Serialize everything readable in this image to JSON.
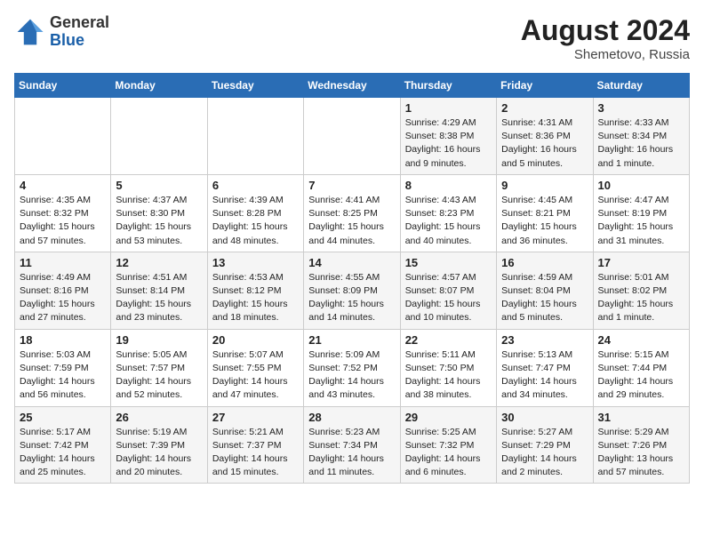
{
  "logo": {
    "general": "General",
    "blue": "Blue"
  },
  "title": {
    "month_year": "August 2024",
    "location": "Shemetovo, Russia"
  },
  "weekdays": [
    "Sunday",
    "Monday",
    "Tuesday",
    "Wednesday",
    "Thursday",
    "Friday",
    "Saturday"
  ],
  "weeks": [
    [
      {
        "day": "",
        "info": ""
      },
      {
        "day": "",
        "info": ""
      },
      {
        "day": "",
        "info": ""
      },
      {
        "day": "",
        "info": ""
      },
      {
        "day": "1",
        "info": "Sunrise: 4:29 AM\nSunset: 8:38 PM\nDaylight: 16 hours\nand 9 minutes."
      },
      {
        "day": "2",
        "info": "Sunrise: 4:31 AM\nSunset: 8:36 PM\nDaylight: 16 hours\nand 5 minutes."
      },
      {
        "day": "3",
        "info": "Sunrise: 4:33 AM\nSunset: 8:34 PM\nDaylight: 16 hours\nand 1 minute."
      }
    ],
    [
      {
        "day": "4",
        "info": "Sunrise: 4:35 AM\nSunset: 8:32 PM\nDaylight: 15 hours\nand 57 minutes."
      },
      {
        "day": "5",
        "info": "Sunrise: 4:37 AM\nSunset: 8:30 PM\nDaylight: 15 hours\nand 53 minutes."
      },
      {
        "day": "6",
        "info": "Sunrise: 4:39 AM\nSunset: 8:28 PM\nDaylight: 15 hours\nand 48 minutes."
      },
      {
        "day": "7",
        "info": "Sunrise: 4:41 AM\nSunset: 8:25 PM\nDaylight: 15 hours\nand 44 minutes."
      },
      {
        "day": "8",
        "info": "Sunrise: 4:43 AM\nSunset: 8:23 PM\nDaylight: 15 hours\nand 40 minutes."
      },
      {
        "day": "9",
        "info": "Sunrise: 4:45 AM\nSunset: 8:21 PM\nDaylight: 15 hours\nand 36 minutes."
      },
      {
        "day": "10",
        "info": "Sunrise: 4:47 AM\nSunset: 8:19 PM\nDaylight: 15 hours\nand 31 minutes."
      }
    ],
    [
      {
        "day": "11",
        "info": "Sunrise: 4:49 AM\nSunset: 8:16 PM\nDaylight: 15 hours\nand 27 minutes."
      },
      {
        "day": "12",
        "info": "Sunrise: 4:51 AM\nSunset: 8:14 PM\nDaylight: 15 hours\nand 23 minutes."
      },
      {
        "day": "13",
        "info": "Sunrise: 4:53 AM\nSunset: 8:12 PM\nDaylight: 15 hours\nand 18 minutes."
      },
      {
        "day": "14",
        "info": "Sunrise: 4:55 AM\nSunset: 8:09 PM\nDaylight: 15 hours\nand 14 minutes."
      },
      {
        "day": "15",
        "info": "Sunrise: 4:57 AM\nSunset: 8:07 PM\nDaylight: 15 hours\nand 10 minutes."
      },
      {
        "day": "16",
        "info": "Sunrise: 4:59 AM\nSunset: 8:04 PM\nDaylight: 15 hours\nand 5 minutes."
      },
      {
        "day": "17",
        "info": "Sunrise: 5:01 AM\nSunset: 8:02 PM\nDaylight: 15 hours\nand 1 minute."
      }
    ],
    [
      {
        "day": "18",
        "info": "Sunrise: 5:03 AM\nSunset: 7:59 PM\nDaylight: 14 hours\nand 56 minutes."
      },
      {
        "day": "19",
        "info": "Sunrise: 5:05 AM\nSunset: 7:57 PM\nDaylight: 14 hours\nand 52 minutes."
      },
      {
        "day": "20",
        "info": "Sunrise: 5:07 AM\nSunset: 7:55 PM\nDaylight: 14 hours\nand 47 minutes."
      },
      {
        "day": "21",
        "info": "Sunrise: 5:09 AM\nSunset: 7:52 PM\nDaylight: 14 hours\nand 43 minutes."
      },
      {
        "day": "22",
        "info": "Sunrise: 5:11 AM\nSunset: 7:50 PM\nDaylight: 14 hours\nand 38 minutes."
      },
      {
        "day": "23",
        "info": "Sunrise: 5:13 AM\nSunset: 7:47 PM\nDaylight: 14 hours\nand 34 minutes."
      },
      {
        "day": "24",
        "info": "Sunrise: 5:15 AM\nSunset: 7:44 PM\nDaylight: 14 hours\nand 29 minutes."
      }
    ],
    [
      {
        "day": "25",
        "info": "Sunrise: 5:17 AM\nSunset: 7:42 PM\nDaylight: 14 hours\nand 25 minutes."
      },
      {
        "day": "26",
        "info": "Sunrise: 5:19 AM\nSunset: 7:39 PM\nDaylight: 14 hours\nand 20 minutes."
      },
      {
        "day": "27",
        "info": "Sunrise: 5:21 AM\nSunset: 7:37 PM\nDaylight: 14 hours\nand 15 minutes."
      },
      {
        "day": "28",
        "info": "Sunrise: 5:23 AM\nSunset: 7:34 PM\nDaylight: 14 hours\nand 11 minutes."
      },
      {
        "day": "29",
        "info": "Sunrise: 5:25 AM\nSunset: 7:32 PM\nDaylight: 14 hours\nand 6 minutes."
      },
      {
        "day": "30",
        "info": "Sunrise: 5:27 AM\nSunset: 7:29 PM\nDaylight: 14 hours\nand 2 minutes."
      },
      {
        "day": "31",
        "info": "Sunrise: 5:29 AM\nSunset: 7:26 PM\nDaylight: 13 hours\nand 57 minutes."
      }
    ]
  ]
}
